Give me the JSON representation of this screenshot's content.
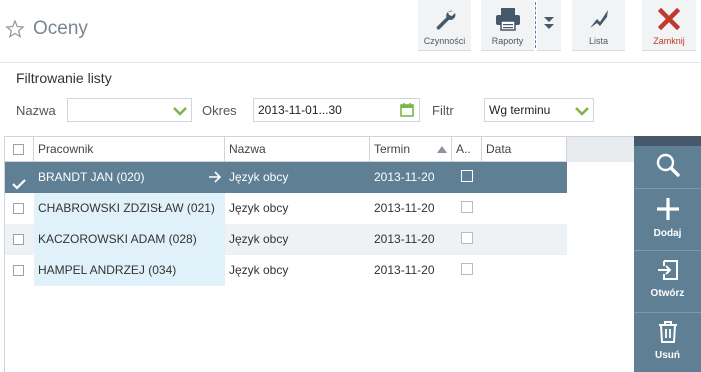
{
  "window": {
    "title": "Oceny"
  },
  "toolbar": {
    "actions_label": "Czynności",
    "reports_label": "Raporty",
    "list_label": "Lista",
    "close_label": "Zamknij"
  },
  "filter": {
    "title": "Filtrowanie listy",
    "name_label": "Nazwa",
    "name_value": "",
    "period_label": "Okres",
    "period_value": "2013-11-01...30",
    "filter_label": "Filtr",
    "filter_value": "Wg terminu"
  },
  "grid": {
    "columns": [
      "Pracownik",
      "Nazwa",
      "Termin",
      "A..",
      "Data"
    ],
    "rows": [
      {
        "employee": "BRANDT JAN (020)",
        "name": "Język obcy",
        "term": "2013-11-20",
        "checked": true,
        "selected": true
      },
      {
        "employee": "CHABROWSKI ZDZISŁAW (021)",
        "name": "Język obcy",
        "term": "2013-11-20",
        "checked": false,
        "selected": false
      },
      {
        "employee": "KACZOROWSKI ADAM (028)",
        "name": "Język obcy",
        "term": "2013-11-20",
        "checked": false,
        "selected": false
      },
      {
        "employee": "HAMPEL ANDRZEJ (034)",
        "name": "Język obcy",
        "term": "2013-11-20",
        "checked": false,
        "selected": false
      }
    ]
  },
  "side": {
    "search_icon": "search-icon",
    "add_label": "Dodaj",
    "open_label": "Otwórz",
    "delete_label": "Usuń"
  },
  "colors": {
    "accent": "#5f7f94",
    "chevron": "#7ab648",
    "close_red": "#c0392b",
    "employee_cell": "#e1f1fa"
  }
}
